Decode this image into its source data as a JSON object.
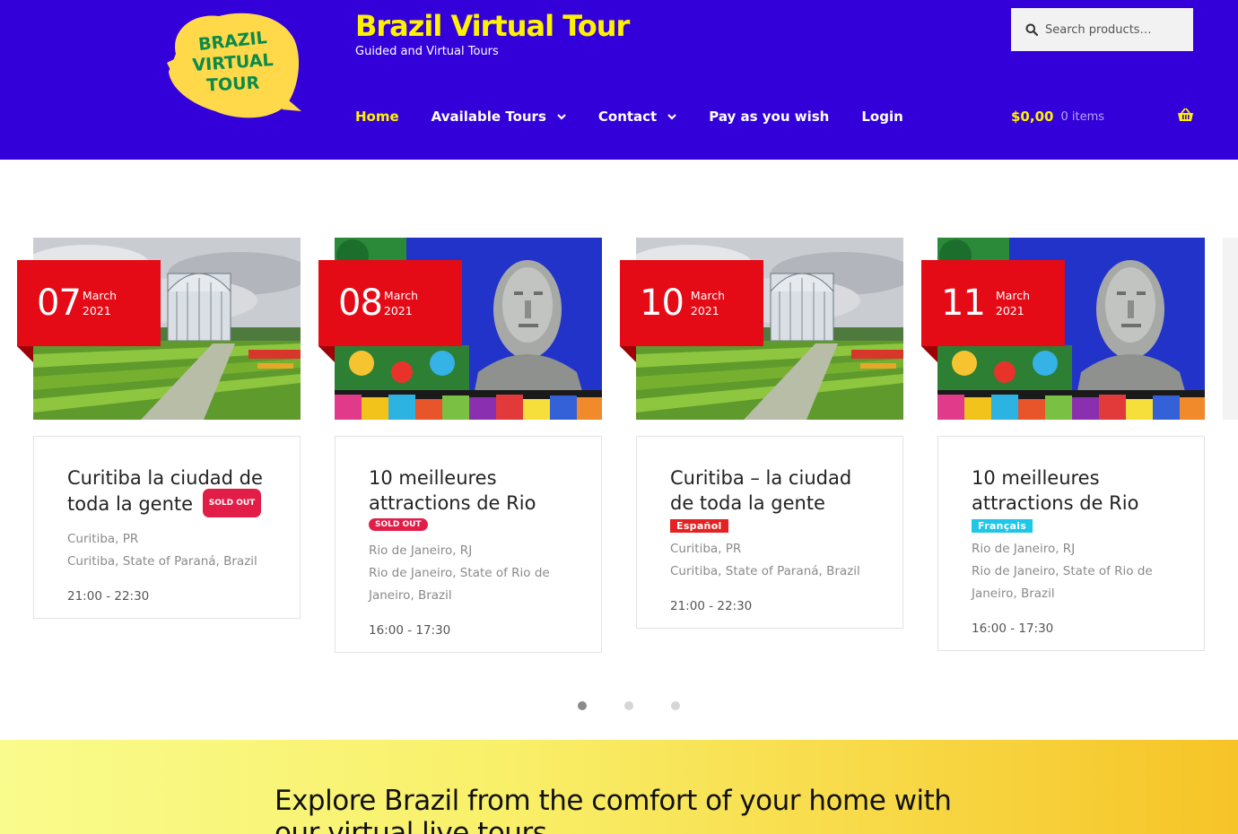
{
  "header": {
    "logo_text": [
      "BRAZIL",
      "VIRTUAL",
      "TOUR"
    ],
    "site_title": "Brazil Virtual Tour",
    "tagline": "Guided and Virtual Tours",
    "search_placeholder": "Search products…",
    "nav": [
      {
        "label": "Home",
        "active": true,
        "has_dropdown": false
      },
      {
        "label": "Available Tours",
        "active": false,
        "has_dropdown": true
      },
      {
        "label": "Contact",
        "active": false,
        "has_dropdown": true
      },
      {
        "label": "Pay as you wish",
        "active": false,
        "has_dropdown": false
      },
      {
        "label": "Login",
        "active": false,
        "has_dropdown": false
      }
    ],
    "cart": {
      "amount": "$0,00",
      "count": "0 items",
      "icon": "basket-icon"
    }
  },
  "tours": [
    {
      "day": "07",
      "month": "March",
      "year": "2021",
      "image": "curitiba-botanical-garden",
      "title": "Curitiba la ciudad de toda la gente",
      "badge": "SOLD OUT",
      "location_short": "Curitiba, PR",
      "location_full": "Curitiba, State of Paraná, Brazil",
      "time": "21:00 - 22:30"
    },
    {
      "day": "08",
      "month": "March",
      "year": "2021",
      "image": "rio-christ-redeemer",
      "title": "10 meilleures attractions de Rio",
      "badge": "SOLD OUT",
      "location_short": "Rio de Janeiro, RJ",
      "location_full": "Rio de Janeiro, State of Rio de Janeiro, Brazil",
      "time": "16:00 - 17:30"
    },
    {
      "day": "10",
      "month": "March",
      "year": "2021",
      "image": "curitiba-botanical-garden",
      "title": "Curitiba – la ciudad de toda la gente",
      "language": "Español",
      "location_short": "Curitiba, PR",
      "location_full": "Curitiba, State of Paraná, Brazil",
      "time": "21:00 - 22:30"
    },
    {
      "day": "11",
      "month": "March",
      "year": "2021",
      "image": "rio-christ-redeemer",
      "title": "10 meilleures attractions de Rio",
      "language": "Français",
      "location_short": "Rio de Janeiro, RJ",
      "location_full": "Rio de Janeiro, State of Rio de Janeiro, Brazil",
      "time": "16:00 - 17:30"
    }
  ],
  "carousel": {
    "pages": 3,
    "current": 1
  },
  "promo": {
    "title": "Explore Brazil from the comfort of your home with our virtual live tours"
  },
  "colors": {
    "header_bg": "#3300d9",
    "brand_yellow": "#fff200",
    "date_red": "#e40b16",
    "sold_out": "#e21d48",
    "espanol": "#e52222",
    "francais": "#1ec7e8"
  }
}
